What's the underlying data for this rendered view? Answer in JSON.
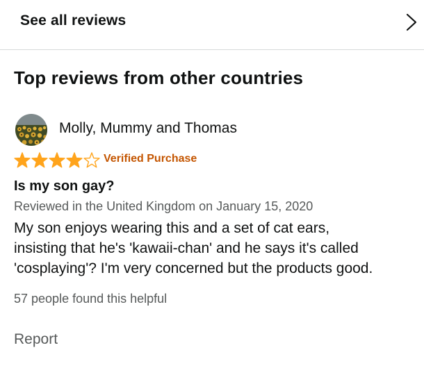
{
  "see_all": {
    "label": "See all reviews",
    "icon": "chevron-right-icon"
  },
  "section": {
    "title": "Top reviews from other countries"
  },
  "review": {
    "reviewer_name": "Molly, Mummy and Thomas",
    "avatar": "sunflower-field-avatar",
    "rating": 4,
    "rating_max": 5,
    "star_color": "#ffa41c",
    "verified_label": "Verified Purchase",
    "verified_color": "#c45500",
    "title": "Is my son gay?",
    "meta": "Reviewed in the United Kingdom on January 15, 2020",
    "body_lines": [
      "My son enjoys wearing this and a set of cat ears,",
      "insisting that he's 'kawaii-chan' and he says it's called",
      "'cosplaying'? I'm very concerned but the products good."
    ],
    "helpful_text": "57 people found this helpful",
    "report_label": "Report"
  }
}
